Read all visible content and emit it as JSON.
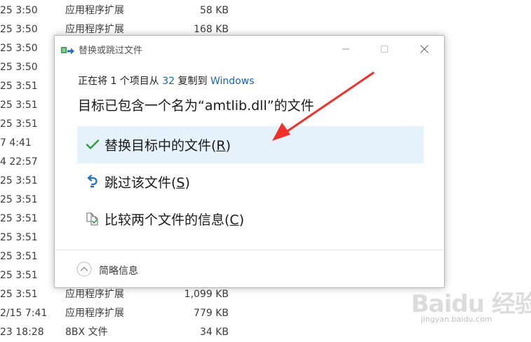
{
  "file_list": {
    "rows": [
      {
        "date": "25 3:50",
        "type": "应用程序扩展",
        "size": "58 KB"
      },
      {
        "date": "25 3:50",
        "type": "应用程序扩展",
        "size": "168 KB"
      },
      {
        "date": "25 3:50",
        "type": "",
        "size": ""
      },
      {
        "date": "25 3:50",
        "type": "",
        "size": ""
      },
      {
        "date": "25 3:51",
        "type": "",
        "size": ""
      },
      {
        "date": "25 3:51",
        "type": "",
        "size": ""
      },
      {
        "date": "25 3:51",
        "type": "",
        "size": ""
      },
      {
        "date": "7 4:41",
        "type": "",
        "size": ""
      },
      {
        "date": "4 22:57",
        "type": "",
        "size": ""
      },
      {
        "date": "25 3:51",
        "type": "",
        "size": ""
      },
      {
        "date": "25 3:51",
        "type": "",
        "size": ""
      },
      {
        "date": "25 3:51",
        "type": "",
        "size": ""
      },
      {
        "date": "25 3:51",
        "type": "",
        "size": ""
      },
      {
        "date": "25 3:51",
        "type": "",
        "size": ""
      },
      {
        "date": "25 3:51",
        "type": "",
        "size": ""
      },
      {
        "date": "25 3:51",
        "type": "应用程序扩展",
        "size": "1,099 KB"
      },
      {
        "date": "2/15 7:41",
        "type": "应用程序扩展",
        "size": "779 KB"
      },
      {
        "date": "23 18:28",
        "type": "8BX 文件",
        "size": "34 KB"
      }
    ]
  },
  "dialog": {
    "title": "替换或跳过文件",
    "copy_info": {
      "prefix": "正在将 1 个项目从 ",
      "source": "32",
      "middle": " 复制到 ",
      "destination": "Windows"
    },
    "heading": "目标已包含一个名为“amtlib.dll”的文件",
    "options": [
      {
        "label_main": "替换目标中的文件(",
        "hotkey": "R",
        "label_end": ")",
        "icon": "checkmark-icon",
        "selected": true
      },
      {
        "label_main": "跳过该文件(",
        "hotkey": "S",
        "label_end": ")",
        "icon": "skip-arrow-icon",
        "selected": false
      },
      {
        "label_main": "比较两个文件的信息(",
        "hotkey": "C",
        "label_end": ")",
        "icon": "compare-files-icon",
        "selected": false
      }
    ],
    "details_label": "简略信息",
    "colors": {
      "accent": "#1565b4",
      "selected_bg": "#e5f1fb",
      "check": "#2d9b3e",
      "arrow": "#f2302a"
    }
  },
  "watermark": {
    "title": "Baidu 经验",
    "url": "jingyan.baidu.com"
  }
}
